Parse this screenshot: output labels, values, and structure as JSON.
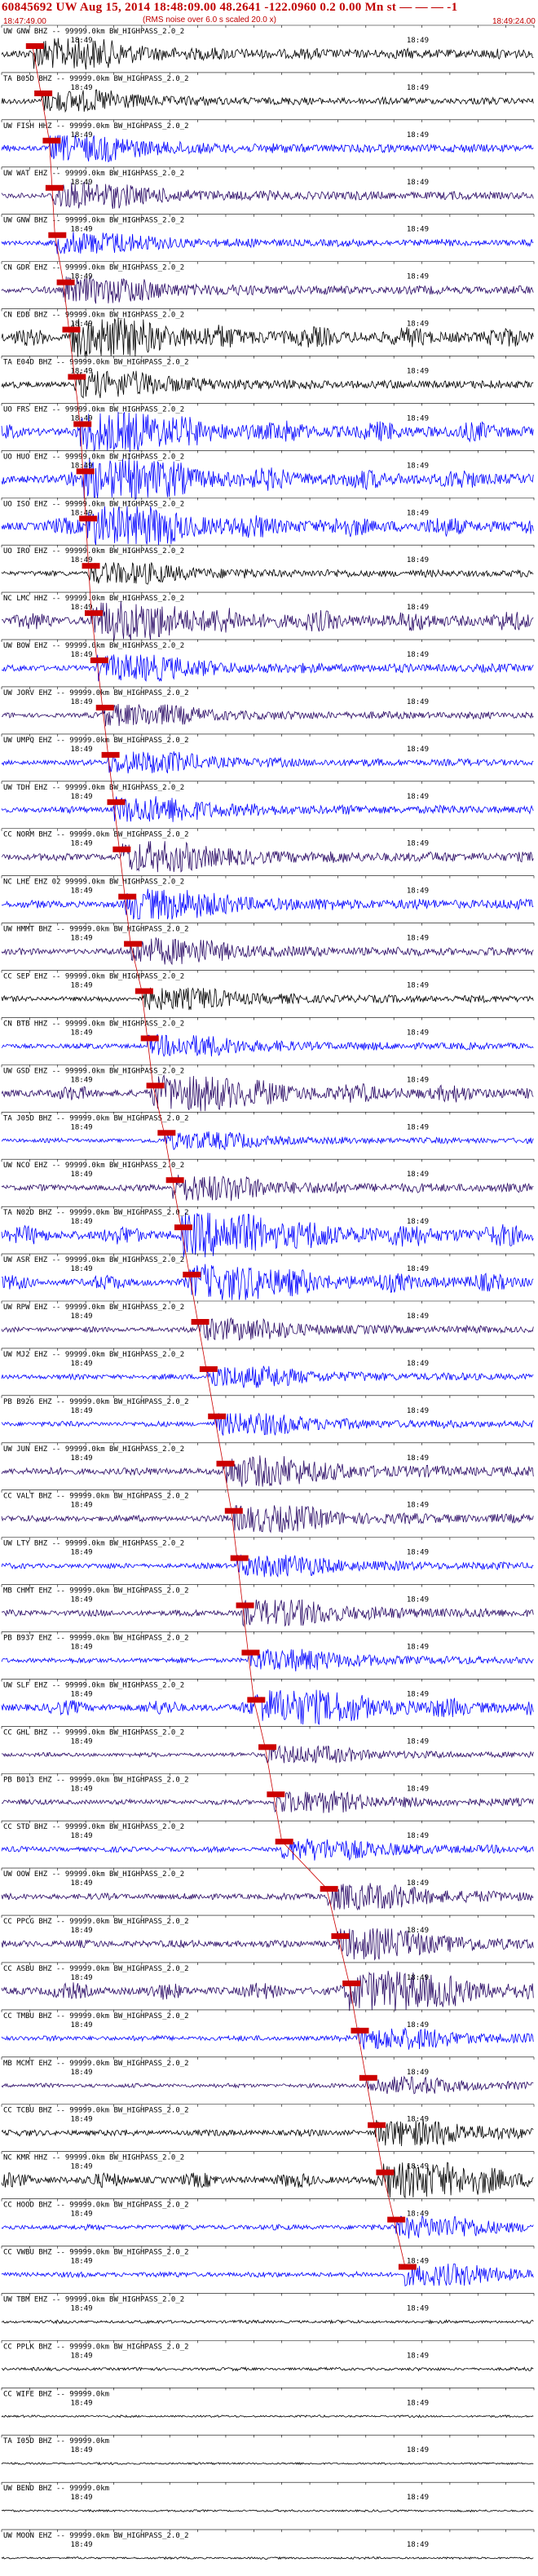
{
  "header": {
    "title": "60845692 UW Aug 15, 2014 18:48:09.00    48.2641 -122.0960  0.2 0.00 Mn st — — — -1",
    "subtitle": "(RMS noise over 6.0 s scaled 20.0 x)",
    "start_time": "18:47:49.00",
    "end_time": "18:49:24.00"
  },
  "colors": {
    "header_red": "#c00000",
    "tick_red": "#cc0000",
    "pick_red": "#cc0000",
    "trace_black": "#000000",
    "trace_blue": "#0000ff",
    "trace_indigo": "#2a0a66",
    "axis": "#000000"
  },
  "chart_data": {
    "type": "line",
    "x_unit": "seconds",
    "xlim": [
      0,
      95
    ],
    "x_tick_label": "18:49",
    "x_tick_positions": [
      12,
      72
    ],
    "series": [
      {
        "label": "UW GNW BHZ -- 99999.0km BW_HIGHPASS_2.0_2",
        "pick": 5.5,
        "color": "black",
        "amp": 0.7
      },
      {
        "label": "TA B05D BHZ -- 99999.0km BW_HIGHPASS_2.0_2",
        "pick": 7.0,
        "color": "black",
        "amp": 0.5
      },
      {
        "label": "UW FISH HHZ -- 99999.0km BW_HIGHPASS_2.0_2",
        "pick": 8.5,
        "color": "blue",
        "amp": 0.6
      },
      {
        "label": "UW WAT EHZ -- 99999.0km BW_HIGHPASS_2.0_2",
        "pick": 9.0,
        "color": "indigo",
        "amp": 0.6
      },
      {
        "label": "UW GNW BHZ -- 99999.0km BW_HIGHPASS_2.0_2",
        "pick": 9.5,
        "color": "blue",
        "amp": 0.5
      },
      {
        "label": "CN GDR EHZ -- 99999.0km BW_HIGHPASS_2.0_2",
        "pick": 11.0,
        "color": "indigo",
        "amp": 0.6
      },
      {
        "label": "CN EDB BHZ -- 99999.0km BW_HIGHPASS_2.0_2",
        "pick": 12.0,
        "color": "black",
        "amp": 0.9
      },
      {
        "label": "TA E04D BHZ -- 99999.0km BW_HIGHPASS_2.0_2",
        "pick": 13.0,
        "color": "black",
        "amp": 0.6
      },
      {
        "label": "UO FRS EHZ -- 99999.0km BW_HIGHPASS_2.0_2",
        "pick": 14.0,
        "color": "blue",
        "amp": 0.9
      },
      {
        "label": "UO HUO EHZ -- 99999.0km BW_HIGHPASS_2.0_2",
        "pick": 14.5,
        "color": "blue",
        "amp": 0.9
      },
      {
        "label": "UO ISO EHZ -- 99999.0km BW_HIGHPASS_2.0_2",
        "pick": 15.0,
        "color": "blue",
        "amp": 0.9
      },
      {
        "label": "UO IRO EHZ -- 99999.0km BW_HIGHPASS_2.0_2",
        "pick": 15.5,
        "color": "black",
        "amp": 0.5
      },
      {
        "label": "NC LMC HHZ -- 99999.0km BW_HIGHPASS_2.0_2",
        "pick": 16.0,
        "color": "indigo",
        "amp": 0.9
      },
      {
        "label": "UW BOW EHZ -- 99999.0km BW_HIGHPASS_2.0_2",
        "pick": 17.0,
        "color": "blue",
        "amp": 0.6
      },
      {
        "label": "UW JORV EHZ -- 99999.0km BW_HIGHPASS_2.0_2",
        "pick": 18.0,
        "color": "indigo",
        "amp": 0.5
      },
      {
        "label": "UW UMPQ EHZ -- 99999.0km BW_HIGHPASS_2.0_2",
        "pick": 19.0,
        "color": "blue",
        "amp": 0.5
      },
      {
        "label": "UW TDH EHZ -- 99999.0km BW_HIGHPASS_2.0_2",
        "pick": 20.0,
        "color": "blue",
        "amp": 0.6
      },
      {
        "label": "CC NORM BHZ -- 99999.0km BW_HIGHPASS_2.0_2",
        "pick": 21.0,
        "color": "indigo",
        "amp": 0.7
      },
      {
        "label": "NC LHE EHZ 02 99999.0km BW_HIGHPASS_2.0_2",
        "pick": 22.0,
        "color": "blue",
        "amp": 0.7
      },
      {
        "label": "UW HMMT BHZ -- 99999.0km BW_HIGHPASS_2.0_2",
        "pick": 23.0,
        "color": "indigo",
        "amp": 0.6
      },
      {
        "label": "CC SEP EHZ -- 99999.0km BW_HIGHPASS_2.0_2",
        "pick": 25.0,
        "color": "black",
        "amp": 0.5
      },
      {
        "label": "CN BTB HHZ -- 99999.0km BW_HIGHPASS_2.0_2",
        "pick": 26.0,
        "color": "blue",
        "amp": 0.5
      },
      {
        "label": "UW GSD EHZ -- 99999.0km BW_HIGHPASS_2.0_2",
        "pick": 27.0,
        "color": "indigo",
        "amp": 0.8
      },
      {
        "label": "TA J05D BHZ -- 99999.0km BW_HIGHPASS_2.0_2",
        "pick": 29.0,
        "color": "blue",
        "amp": 0.4
      },
      {
        "label": "UW NCO EHZ -- 99999.0km BW_HIGHPASS_2.0_2",
        "pick": 30.5,
        "color": "indigo",
        "amp": 0.6
      },
      {
        "label": "TA N02D BHZ -- 99999.0km BW_HIGHPASS_2.0_2",
        "pick": 32.0,
        "color": "blue",
        "amp": 1.0
      },
      {
        "label": "UW ASR EHZ -- 99999.0km BW_HIGHPASS_2.0_2",
        "pick": 33.5,
        "color": "blue",
        "amp": 0.8
      },
      {
        "label": "UW RPW EHZ -- 99999.0km BW_HIGHPASS_2.0_2",
        "pick": 35.0,
        "color": "indigo",
        "amp": 0.5
      },
      {
        "label": "UW MJ2 EHZ -- 99999.0km BW_HIGHPASS_2.0_2",
        "pick": 36.5,
        "color": "blue",
        "amp": 0.5
      },
      {
        "label": "PB B926 EHZ -- 99999.0km BW_HIGHPASS_2.0_2",
        "pick": 38.0,
        "color": "blue",
        "amp": 0.5
      },
      {
        "label": "UW JUN EHZ -- 99999.0km BW_HIGHPASS_2.0_2",
        "pick": 39.5,
        "color": "indigo",
        "amp": 0.7
      },
      {
        "label": "CC VALT BHZ -- 99999.0km BW_HIGHPASS_2.0_2",
        "pick": 41.0,
        "color": "indigo",
        "amp": 0.6
      },
      {
        "label": "UW LTY BHZ -- 99999.0km BW_HIGHPASS_2.0_2",
        "pick": 42.0,
        "color": "blue",
        "amp": 0.5
      },
      {
        "label": "MB CHMT EHZ -- 99999.0km BW_HIGHPASS_2.0_2",
        "pick": 43.0,
        "color": "indigo",
        "amp": 0.6
      },
      {
        "label": "PB B937 EHZ -- 99999.0km BW_HIGHPASS_2.0_2",
        "pick": 44.0,
        "color": "blue",
        "amp": 0.5
      },
      {
        "label": "UW SLF EHZ -- 99999.0km BW_HIGHPASS_2.0_2",
        "pick": 45.0,
        "color": "blue",
        "amp": 0.8
      },
      {
        "label": "CC GHL BHZ -- 99999.0km BW_HIGHPASS_2.0_2",
        "pick": 47.0,
        "color": "indigo",
        "amp": 0.4
      },
      {
        "label": "PB B013 EHZ -- 99999.0km BW_HIGHPASS_2.0_2",
        "pick": 48.5,
        "color": "indigo",
        "amp": 0.5
      },
      {
        "label": "CC STD BHZ -- 99999.0km BW_HIGHPASS_2.0_2",
        "pick": 50.0,
        "color": "blue",
        "amp": 0.5
      },
      {
        "label": "UW OOW EHZ -- 99999.0km BW_HIGHPASS_2.0_2",
        "pick": 58.0,
        "color": "indigo",
        "amp": 0.6
      },
      {
        "label": "CC PPCG BHZ -- 99999.0km BW_HIGHPASS_2.0_2",
        "pick": 60.0,
        "color": "indigo",
        "amp": 0.7
      },
      {
        "label": "CC ASBU BHZ -- 99999.0km BW_HIGHPASS_2.0_2",
        "pick": 62.0,
        "color": "indigo",
        "amp": 0.9
      },
      {
        "label": "CC TMBU BHZ -- 99999.0km BW_HIGHPASS_2.0_2",
        "pick": 63.5,
        "color": "blue",
        "amp": 0.5
      },
      {
        "label": "MB MCMT EHZ -- 99999.0km BW_HIGHPASS_2.0_2",
        "pick": 65.0,
        "color": "indigo",
        "amp": 0.4
      },
      {
        "label": "CC TCBU BHZ -- 99999.0km BW_HIGHPASS_2.0_2",
        "pick": 66.5,
        "color": "black",
        "amp": 0.6
      },
      {
        "label": "NC KMR HHZ -- 99999.0km BW_HIGHPASS_2.0_2",
        "pick": 68.0,
        "color": "black",
        "amp": 0.8
      },
      {
        "label": "CC HOOD BHZ -- 99999.0km BW_HIGHPASS_2.0_2",
        "pick": 70.0,
        "color": "blue",
        "amp": 0.5
      },
      {
        "label": "CC VWBU BHZ -- 99999.0km BW_HIGHPASS_2.0_2",
        "pick": 72.0,
        "color": "blue",
        "amp": 0.5
      },
      {
        "label": "UW TBM EHZ -- 99999.0km BW_HIGHPASS_2.0_2",
        "pick": null,
        "color": "black",
        "amp": 0.3
      },
      {
        "label": "CC PPLK BHZ -- 99999.0km BW_HIGHPASS_2.0_2",
        "pick": null,
        "color": "black",
        "amp": 0.3
      },
      {
        "label": "CC WIFE BHZ -- 99999.0km",
        "pick": null,
        "color": "black",
        "amp": 0.2
      },
      {
        "label": "TA I05D BHZ -- 99999.0km",
        "pick": null,
        "color": "black",
        "amp": 0.2
      },
      {
        "label": "UW BEND BHZ -- 99999.0km",
        "pick": null,
        "color": "black",
        "amp": 0.2
      },
      {
        "label": "UW MOON EHZ -- 99999.0km BW_HIGHPASS_2.0_2",
        "pick": null,
        "color": "black",
        "amp": 0.2
      }
    ]
  }
}
